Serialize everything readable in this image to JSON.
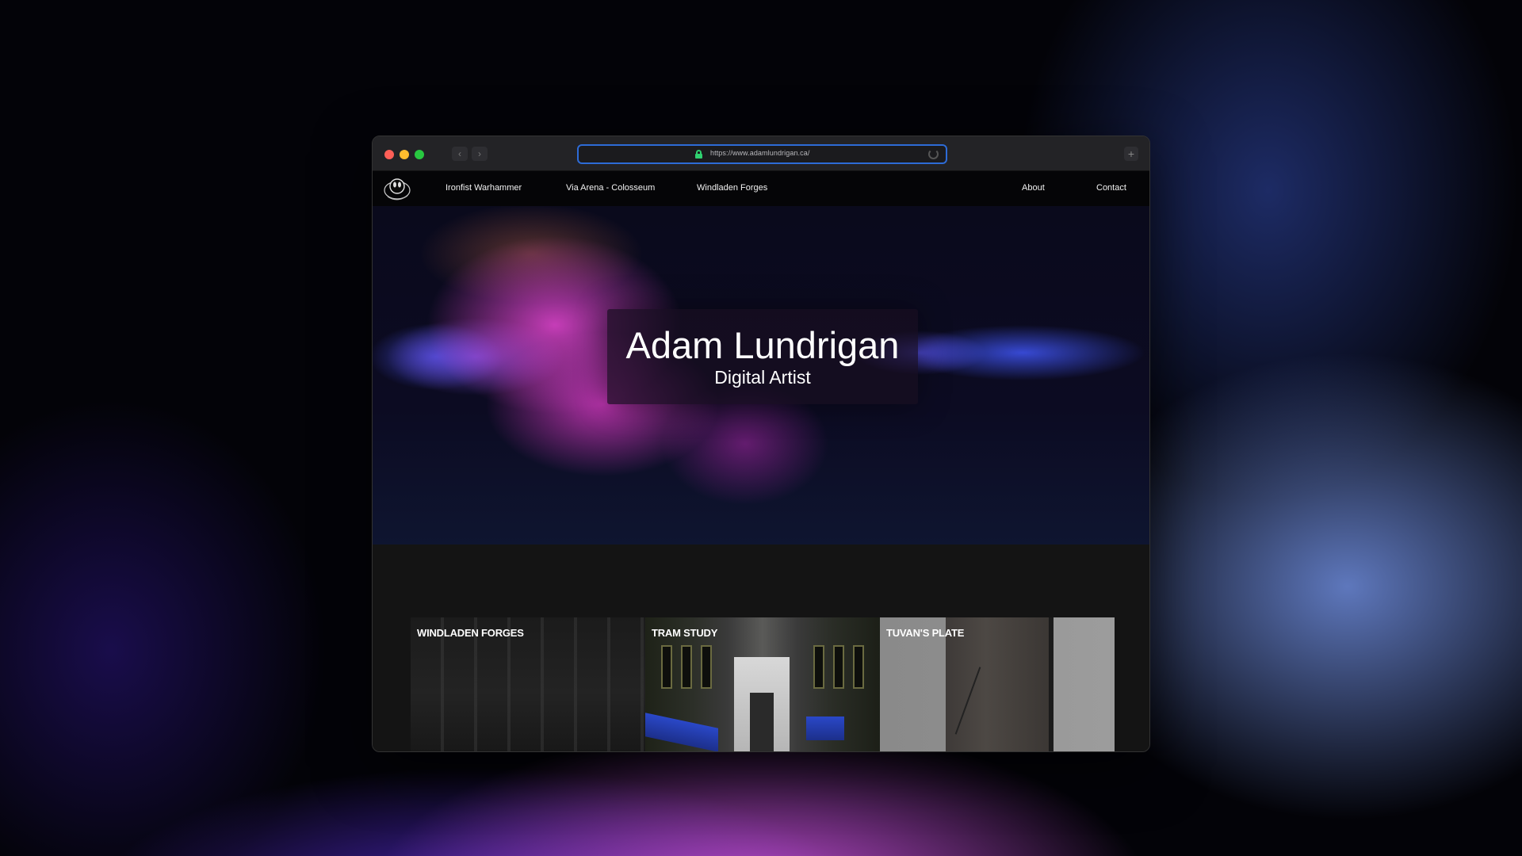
{
  "browser": {
    "url": "https://www.adamlundrigan.ca/",
    "back_icon": "chevron-left-icon",
    "forward_icon": "chevron-right-icon",
    "new_tab_icon": "plus-icon",
    "back_glyph": "‹",
    "forward_glyph": "›",
    "new_tab_glyph": "+"
  },
  "nav": {
    "logo": "logo-icon",
    "links": [
      {
        "label": "Ironfist Warhammer"
      },
      {
        "label": "Via Arena - Colosseum"
      },
      {
        "label": "Windladen Forges"
      }
    ],
    "about_label": "About",
    "contact_label": "Contact"
  },
  "hero": {
    "title": "Adam Lundrigan",
    "subtitle": "Digital Artist"
  },
  "projects": [
    {
      "title": "WINDLADEN FORGES"
    },
    {
      "title": "TRAM STUDY"
    },
    {
      "title": "TUVAN'S PLATE"
    }
  ],
  "colors": {
    "url_border": "#2d6bd6",
    "lock": "#2fd06f",
    "traffic_red": "#ff5f57",
    "traffic_yellow": "#febc2e",
    "traffic_green": "#28c840"
  }
}
